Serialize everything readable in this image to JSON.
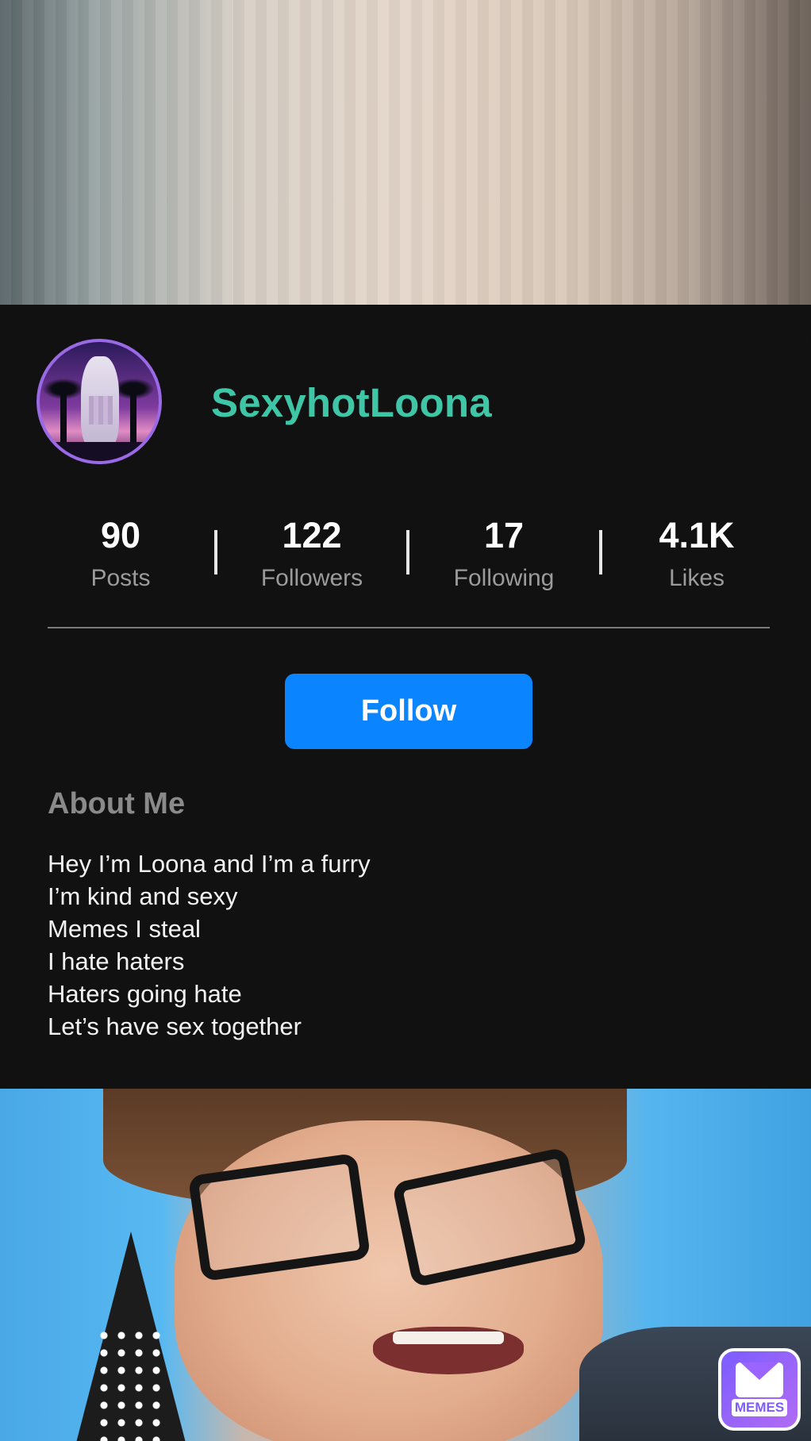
{
  "profile": {
    "username": "SexyhotLoona"
  },
  "stats": [
    {
      "value": "90",
      "label": "Posts"
    },
    {
      "value": "122",
      "label": "Followers"
    },
    {
      "value": "17",
      "label": "Following"
    },
    {
      "value": "4.1K",
      "label": "Likes"
    }
  ],
  "follow_button": {
    "label": "Follow"
  },
  "about": {
    "title": "About Me",
    "lines": [
      "Hey I’m Loona and I’m a furry",
      "I’m kind and sexy",
      "Memes I steal",
      "I hate haters",
      "Haters going hate",
      "Let’s have sex together"
    ]
  },
  "badge": {
    "text": "MEMES"
  },
  "colors": {
    "username": "#3fc6a6",
    "follow_button": "#0a84ff",
    "background": "#111111",
    "avatar_ring": "#9a6ae6",
    "badge": "#7c5cff"
  },
  "icons": {
    "badge": "envelope-icon"
  }
}
